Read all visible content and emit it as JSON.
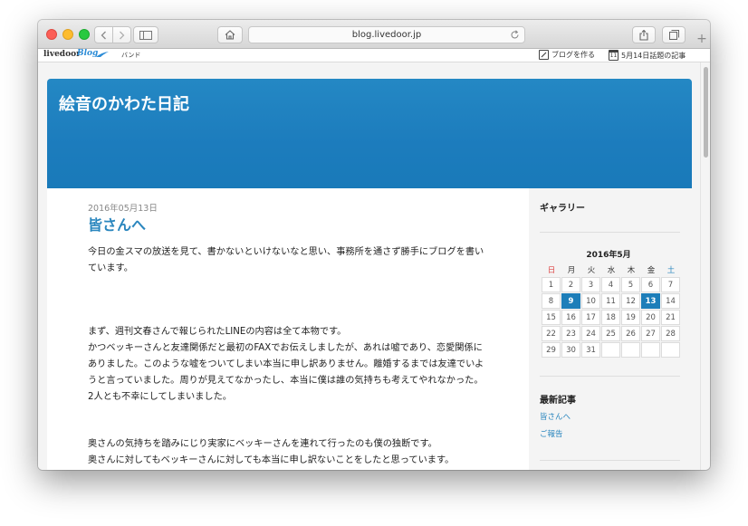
{
  "browser": {
    "url": "blog.livedoor.jp"
  },
  "livedoor_bar": {
    "logo": "livedoor",
    "blog": "Blog",
    "band": "バンド",
    "create_blog": "ブログを作る",
    "topic": "5月14日話題の記事",
    "topic_day": "11"
  },
  "blog": {
    "title": "絵音のかわた日記"
  },
  "post": {
    "date": "2016年05月13日",
    "title": "皆さんへ",
    "paragraphs": [
      "今日の金スマの放送を見て、書かないといけないなと思い、事務所を通さず勝手にブログを書いています。",
      "まず、週刊文春さんで報じられたLINEの内容は全て本物です。\nかつベッキーさんと友達関係だと最初のFAXでお伝えしましたが、あれは嘘であり、恋愛関係にありました。このような嘘をついてしまい本当に申し訳ありません。離婚するまでは友達でいようと言っていました。周りが見えてなかったし、本当に僕は誰の気持ちも考えてやれなかった。2人とも不幸にしてしまいました。",
      "奥さんの気持ちを踏みにじり実家にベッキーさんを連れて行ったのも僕の独断です。\n奥さんに対してもベッキーさんに対しても本当に申し訳ないことをしたと思っています。"
    ]
  },
  "sidebar": {
    "gallery_heading": "ギャラリー",
    "calendar": {
      "title": "2016年5月",
      "weekdays": [
        "日",
        "月",
        "火",
        "水",
        "木",
        "金",
        "土"
      ],
      "days": [
        "1",
        "2",
        "3",
        "4",
        "5",
        "6",
        "7",
        "8",
        "9",
        "10",
        "11",
        "12",
        "13",
        "14",
        "15",
        "16",
        "17",
        "18",
        "19",
        "20",
        "21",
        "22",
        "23",
        "24",
        "25",
        "26",
        "27",
        "28",
        "29",
        "30",
        "31",
        "",
        "",
        "",
        ""
      ],
      "highlighted": [
        "9",
        "13"
      ]
    },
    "recent_heading": "最新記事",
    "recent_posts": [
      "皆さんへ",
      "ご報告"
    ]
  },
  "colors": {
    "header_blue": "#1d7eb9",
    "link_blue": "#2a86be",
    "sunday_red": "#d44444"
  }
}
